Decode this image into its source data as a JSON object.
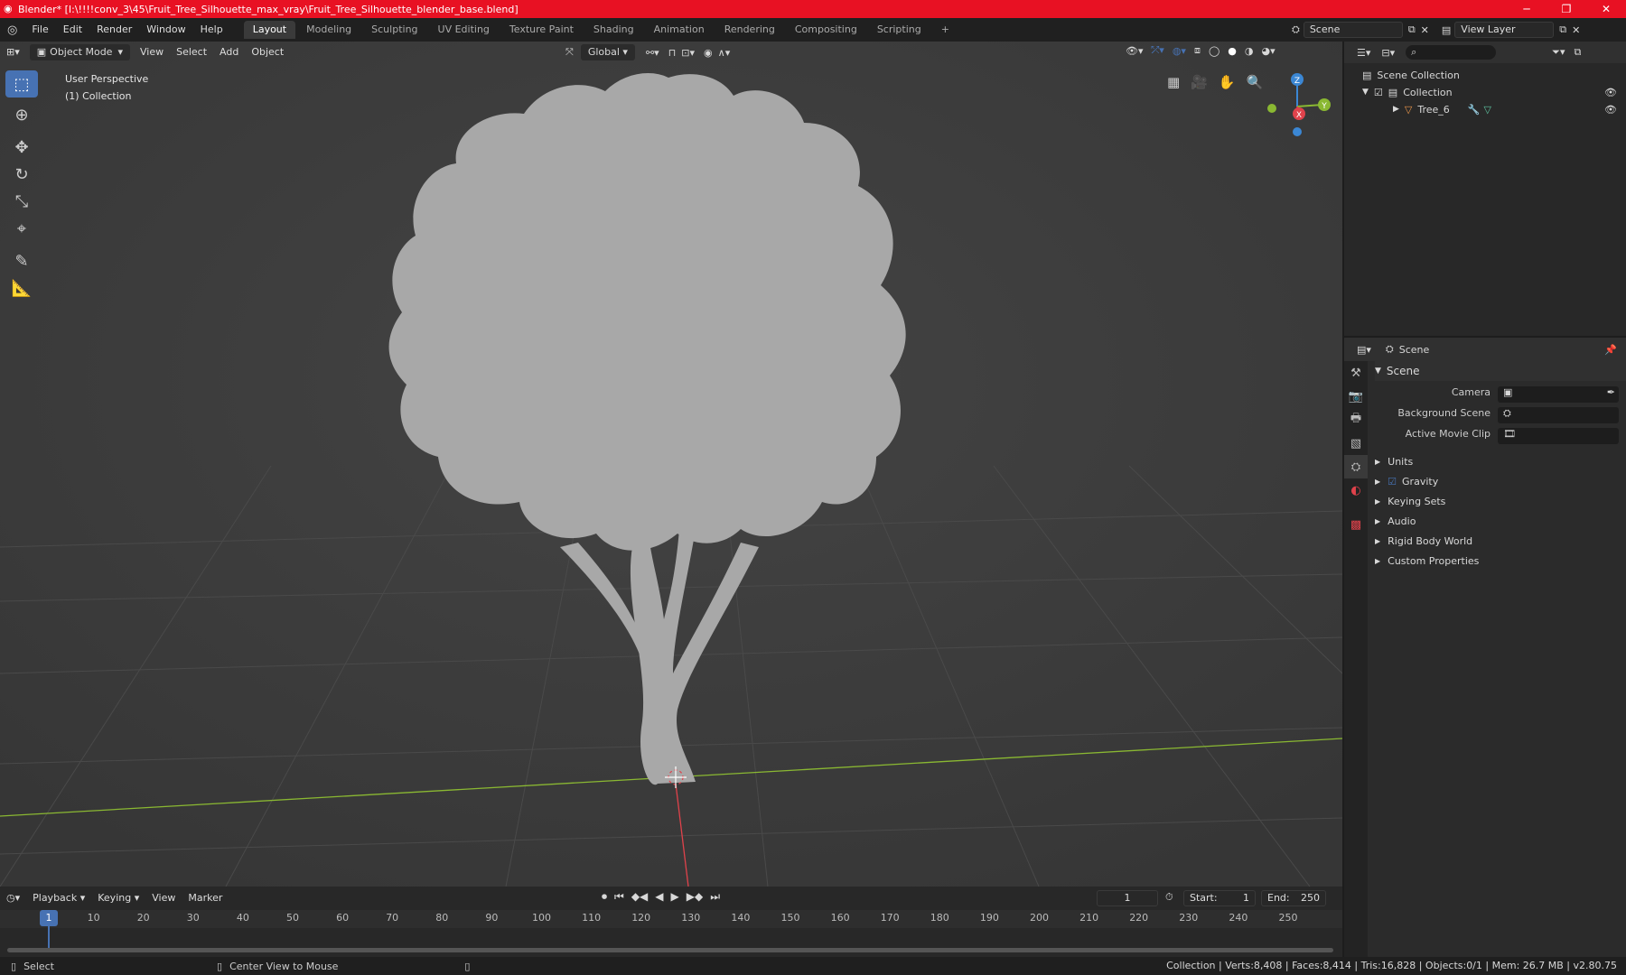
{
  "titlebar": {
    "title": "Blender* [I:\\!!!!conv_3\\45\\Fruit_Tree_Silhouette_max_vray\\Fruit_Tree_Silhouette_blender_base.blend]",
    "minimize": "─",
    "maximize": "❐",
    "close": "✕"
  },
  "menu": {
    "items": [
      "File",
      "Edit",
      "Render",
      "Window",
      "Help"
    ],
    "workspaces": [
      "Layout",
      "Modeling",
      "Sculpting",
      "UV Editing",
      "Texture Paint",
      "Shading",
      "Animation",
      "Rendering",
      "Compositing",
      "Scripting"
    ],
    "active_workspace": "Layout",
    "add_tab": "+",
    "scene": "Scene",
    "view_layer": "View Layer"
  },
  "viewport": {
    "mode": "Object Mode",
    "menus": [
      "View",
      "Select",
      "Add",
      "Object"
    ],
    "orientation": "Global",
    "perspective": "User Perspective",
    "collection": "(1) Collection",
    "gizmo": {
      "z": "Z",
      "y": "Y",
      "x": "X"
    }
  },
  "outliner": {
    "root": "Scene Collection",
    "collection": "Collection",
    "object": "Tree_6"
  },
  "properties": {
    "header": "Scene",
    "panel": "Scene",
    "camera_label": "Camera",
    "bg_scene_label": "Background Scene",
    "movie_clip_label": "Active Movie Clip",
    "sections": [
      "Units",
      "Gravity",
      "Keying Sets",
      "Audio",
      "Rigid Body World",
      "Custom Properties"
    ]
  },
  "timeline": {
    "menus": [
      "Playback",
      "Keying",
      "View",
      "Marker"
    ],
    "current_frame": "1",
    "start_label": "Start:",
    "start": "1",
    "end_label": "End:",
    "end": "250",
    "ticks": [
      "1",
      "10",
      "20",
      "30",
      "40",
      "50",
      "60",
      "70",
      "80",
      "90",
      "100",
      "110",
      "120",
      "130",
      "140",
      "150",
      "160",
      "170",
      "180",
      "190",
      "200",
      "210",
      "220",
      "230",
      "240",
      "250"
    ]
  },
  "status": {
    "select": "Select",
    "center": "Center View to Mouse",
    "stats": "Collection | Verts:8,408 | Faces:8,414 | Tris:16,828 | Objects:0/1 | Mem: 26.7 MB | v2.80.75"
  },
  "colors": {
    "accent": "#4772b3",
    "titlebar": "#e81123",
    "x_axis": "#e0424b",
    "y_axis": "#8ab832",
    "z_axis": "#3b87d4"
  }
}
